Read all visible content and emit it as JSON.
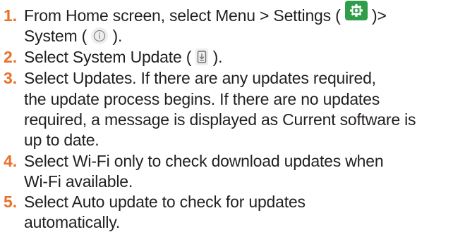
{
  "steps": [
    {
      "number": "1.",
      "lines": [
        "From Home screen, select Menu > Settings (",
        ")>",
        "System (",
        ")."
      ]
    },
    {
      "number": "2.",
      "lines": [
        "Select System Update (",
        ")."
      ]
    },
    {
      "number": "3.",
      "lines": [
        "Select Updates. If there are any updates required,",
        "the update process begins. If there are no updates",
        "required, a message is displayed as Current software is",
        "up to date."
      ]
    },
    {
      "number": "4.",
      "lines": [
        "Select Wi-Fi only to check download updates when",
        "Wi-Fi available."
      ]
    },
    {
      "number": "5.",
      "lines": [
        "Select Auto update to check for updates",
        "automatically."
      ]
    }
  ],
  "icons": {
    "settings": "settings-gear-icon",
    "system": "info-icon",
    "system_update": "system-update-icon"
  },
  "colors": {
    "step_number": "#e8702a",
    "text": "#231f20",
    "settings_icon_bg": "#2f9d4a"
  }
}
